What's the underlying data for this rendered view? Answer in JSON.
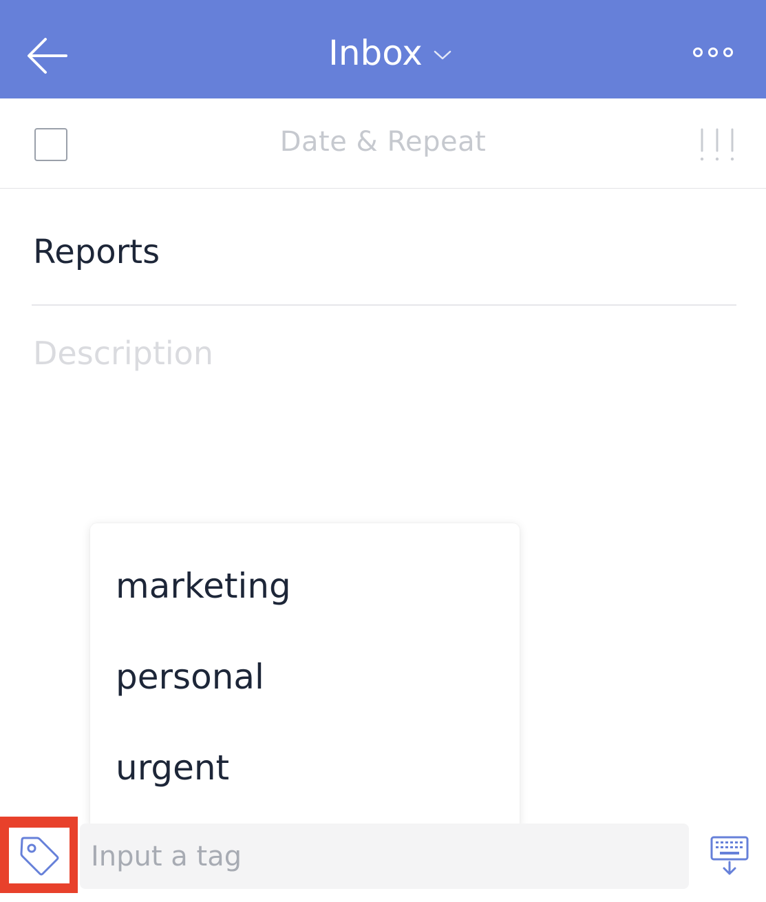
{
  "header": {
    "title": "Inbox",
    "back_icon": "arrow-left-icon",
    "dropdown_icon": "chevron-down-icon",
    "more_icon": "more-dots-icon",
    "background_color": "#6680d9"
  },
  "date_row": {
    "checkbox_checked": false,
    "date_label": "Date & Repeat",
    "priority_icon": "priority-icon"
  },
  "task": {
    "title": "Reports",
    "description_placeholder": "Description"
  },
  "tag_suggestions": [
    {
      "label": "marketing"
    },
    {
      "label": "personal"
    },
    {
      "label": "urgent"
    }
  ],
  "tag_bar": {
    "tag_icon": "tag-icon",
    "input_placeholder": "Input a tag",
    "input_value": "",
    "keyboard_icon": "keyboard-hide-icon",
    "highlight_color": "#e8412b"
  }
}
